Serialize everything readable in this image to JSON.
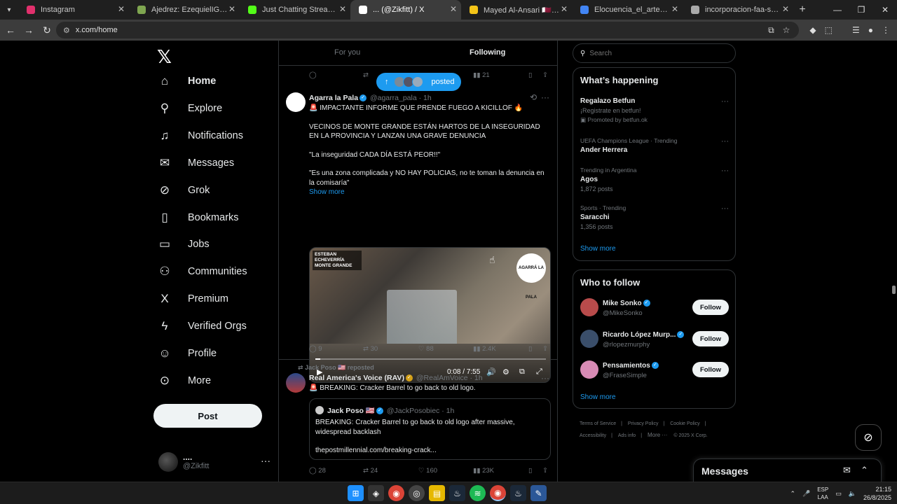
{
  "browser": {
    "tabs": [
      {
        "label": "Instagram",
        "color": "#e1306c"
      },
      {
        "label": "Ajedrez: EzequielIGonzalez25 vs",
        "color": "#7fa650"
      },
      {
        "label": "Just Chatting Streaming - Live",
        "color": "#53fc18"
      },
      {
        "label": "... (@Zikfitt) / X",
        "color": "#ffffff"
      },
      {
        "label": "Mayed Al-Ansari 🇶🇦 (@m1ydd",
        "color": "#f5c518"
      },
      {
        "label": "Elocuencia_el_arte_de_hablar_P",
        "color": "#4285f4"
      },
      {
        "label": "incorporacion-faa-seguridad-y-",
        "color": "#aaaaaa"
      }
    ],
    "url": "x.com/home"
  },
  "nav": {
    "items": [
      {
        "label": "Home",
        "icon": "home-icon",
        "glyph": "⌂"
      },
      {
        "label": "Explore",
        "icon": "search-icon",
        "glyph": "⚲"
      },
      {
        "label": "Notifications",
        "icon": "bell-icon",
        "glyph": "♫"
      },
      {
        "label": "Messages",
        "icon": "envelope-icon",
        "glyph": "✉"
      },
      {
        "label": "Grok",
        "icon": "grok-icon",
        "glyph": "⊘"
      },
      {
        "label": "Bookmarks",
        "icon": "bookmark-icon",
        "glyph": "▯"
      },
      {
        "label": "Jobs",
        "icon": "briefcase-icon",
        "glyph": "▭"
      },
      {
        "label": "Communities",
        "icon": "people-icon",
        "glyph": "⚇"
      },
      {
        "label": "Premium",
        "icon": "x-premium-icon",
        "glyph": "X"
      },
      {
        "label": "Verified Orgs",
        "icon": "lightning-icon",
        "glyph": "ϟ"
      },
      {
        "label": "Profile",
        "icon": "person-icon",
        "glyph": "☺"
      },
      {
        "label": "More",
        "icon": "more-circle-icon",
        "glyph": "⊙"
      }
    ],
    "post_label": "Post",
    "account_name": "....",
    "account_handle": "@Zikfitt"
  },
  "timeline": {
    "tabs": [
      "For you",
      "Following"
    ],
    "top_actions": {
      "views": "21"
    },
    "posted_pill": "posted",
    "tweet1": {
      "author": "Agarra la Pala",
      "handle": "@agarra_pala",
      "time": "1h",
      "line1": "🚨 IMPACTANTE INFORME QUE PRENDE FUEGO A KICILLOF 🔥",
      "line2": "VECINOS DE MONTE GRANDE ESTÁN HARTOS DE LA INSEGURIDAD EN LA PROVINCIA Y LANZAN UNA GRAVE DENUNCIA",
      "line3": "\"La inseguridad CADA DÍA ESTÁ PEOR!!\"",
      "line4": "\"Es una zona complicada y NO HAY POLICIAS, no te toman la denuncia en la comisaría\"",
      "show_more": "Show more",
      "video_tag": "ESTEBAN ECHEVERRÍA MONTE GRANDE",
      "video_brand": "AGARRÁ LA PALA",
      "video_time": "0:08 / 7:55",
      "video_progress": 0.02,
      "replies": "9",
      "reposts": "30",
      "likes": "88",
      "views": "2.4K"
    },
    "tweet2": {
      "repost_by": "Jack Poso 🇺🇸 reposted",
      "author": "Real America's Voice (RAV)",
      "handle": "@RealAmVoice",
      "time": "1h",
      "text": "🚨 BREAKING: Cracker Barrel to go back to old logo.",
      "quote_author": "Jack Poso 🇺🇸",
      "quote_handle": "@JackPosobiec",
      "quote_time": "1h",
      "quote_text": "BREAKING: Cracker Barrel to go back to old logo after massive, widespread backlash",
      "quote_link": "thepostmillennial.com/breaking-crack...",
      "replies": "28",
      "reposts": "24",
      "likes": "160",
      "views": "23K"
    }
  },
  "sidebar": {
    "search_placeholder": "Search",
    "whats_happening": "What’s happening",
    "trends": [
      {
        "ctx": "",
        "title": "Regalazo Betfun",
        "sub": "¡Registrate en betfun!",
        "sub2": "Promoted by betfun.ok"
      },
      {
        "ctx": "UEFA Champions League · Trending",
        "title": "Ander Herrera",
        "sub": "",
        "sub2": ""
      },
      {
        "ctx": "Trending in Argentina",
        "title": "Agos",
        "sub": "1,872 posts",
        "sub2": ""
      },
      {
        "ctx": "Sports · Trending",
        "title": "Saracchi",
        "sub": "1,356 posts",
        "sub2": ""
      }
    ],
    "show_more": "Show more",
    "who_to_follow": "Who to follow",
    "follow_label": "Follow",
    "people": [
      {
        "name": "Mike Sonko",
        "handle": "@MikeSonko",
        "color": "#b84b4b"
      },
      {
        "name": "Ricardo López Murp...",
        "handle": "@rlopezmurphy",
        "color": "#3a4e6a"
      },
      {
        "name": "Pensamientos",
        "handle": "@FraseSimple",
        "color": "#d88bb5"
      }
    ],
    "footer": [
      "Terms of Service",
      "Privacy Policy",
      "Cookie Policy",
      "Accessibility",
      "Ads info",
      "More ···",
      "© 2025 X Corp."
    ]
  },
  "messages_drawer": {
    "title": "Messages"
  },
  "taskbar": {
    "lang": "ESP",
    "lang2": "LAA",
    "time": "21:15",
    "date": "26/8/2025"
  }
}
